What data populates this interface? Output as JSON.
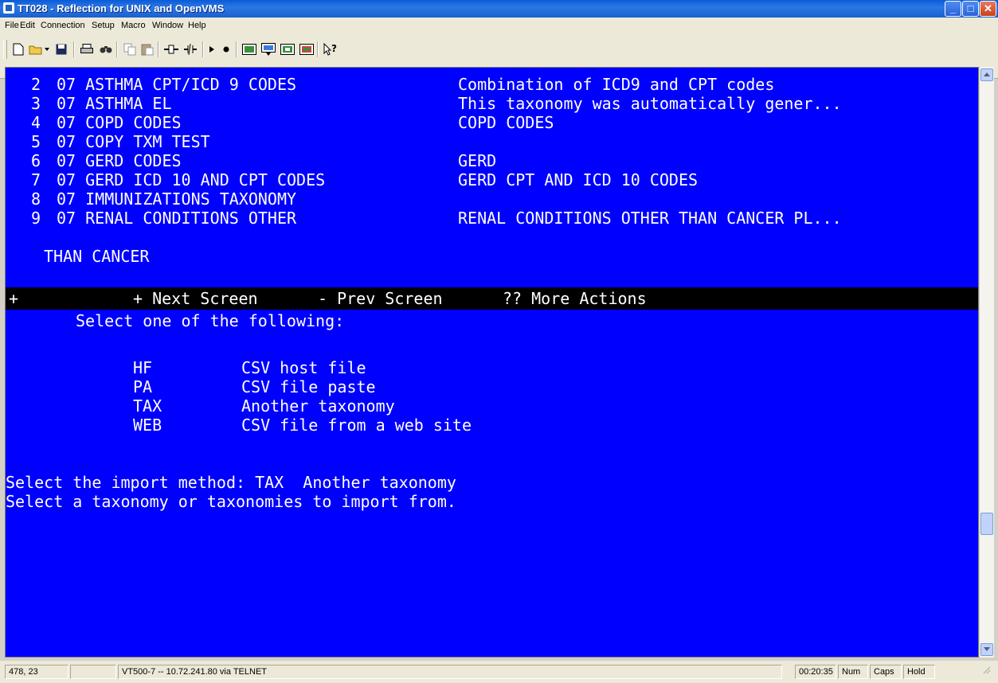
{
  "window": {
    "title": "TT028 - Reflection for UNIX and OpenVMS",
    "controls": {
      "minimize": "_",
      "maximize": "□",
      "close": "✕"
    }
  },
  "menu": [
    "File",
    "Edit",
    "Connection",
    "Setup",
    "Macro",
    "Window",
    "Help"
  ],
  "toolbar": {
    "icons": [
      "new-icon",
      "open-icon",
      "save-icon",
      "print-icon",
      "find-icon",
      "copy-icon",
      "paste-icon",
      "connect-icon",
      "disconnect-icon",
      "play-macro-icon",
      "record-macro-icon",
      "settings-icon",
      "keyboard-icon",
      "display-icon",
      "terminal-icon",
      "whats-this-icon"
    ]
  },
  "terminal": {
    "colors": {
      "background": "#0000ff",
      "text": "#ffffff",
      "bar": "#000000"
    },
    "list": [
      {
        "num": "2",
        "name": "07 ASTHMA CPT/ICD 9 CODES",
        "desc": "Combination of ICD9 and CPT codes"
      },
      {
        "num": "3",
        "name": "07 ASTHMA EL",
        "desc": "This taxonomy was automatically gener..."
      },
      {
        "num": "4",
        "name": "07 COPD CODES",
        "desc": "COPD CODES"
      },
      {
        "num": "5",
        "name": "07 COPY TXM TEST",
        "desc": ""
      },
      {
        "num": "6",
        "name": "07 GERD CODES",
        "desc": "GERD"
      },
      {
        "num": "7",
        "name": "07 GERD ICD 10 AND CPT CODES",
        "desc": "GERD CPT AND ICD 10 CODES"
      },
      {
        "num": "8",
        "name": "07 IMMUNIZATIONS TAXONOMY",
        "desc": ""
      },
      {
        "num": "9",
        "name": "07 RENAL CONDITIONS OTHER",
        "desc": "RENAL CONDITIONS OTHER THAN CANCER PL..."
      }
    ],
    "list_continuation": "THAN CANCER",
    "action_bar": {
      "marker": "+",
      "next": "+ Next Screen",
      "prev": "- Prev Screen",
      "more": "?? More Actions"
    },
    "prompt_header": "Select one of the following:",
    "options": [
      {
        "code": "HF",
        "label": "CSV host file"
      },
      {
        "code": "PA",
        "label": "CSV file paste"
      },
      {
        "code": "TAX",
        "label": "Another taxonomy"
      },
      {
        "code": "WEB",
        "label": "CSV file from a web site"
      }
    ],
    "import_line": "Select the import method: TAX  Another taxonomy",
    "select_line": "Select a taxonomy or taxonomies to import from."
  },
  "statusbar": {
    "cursor": "478, 23",
    "connection": "VT500-7 -- 10.72.241.80 via TELNET",
    "time": "00:20:35",
    "num": "Num",
    "caps": "Caps",
    "hold": "Hold"
  }
}
